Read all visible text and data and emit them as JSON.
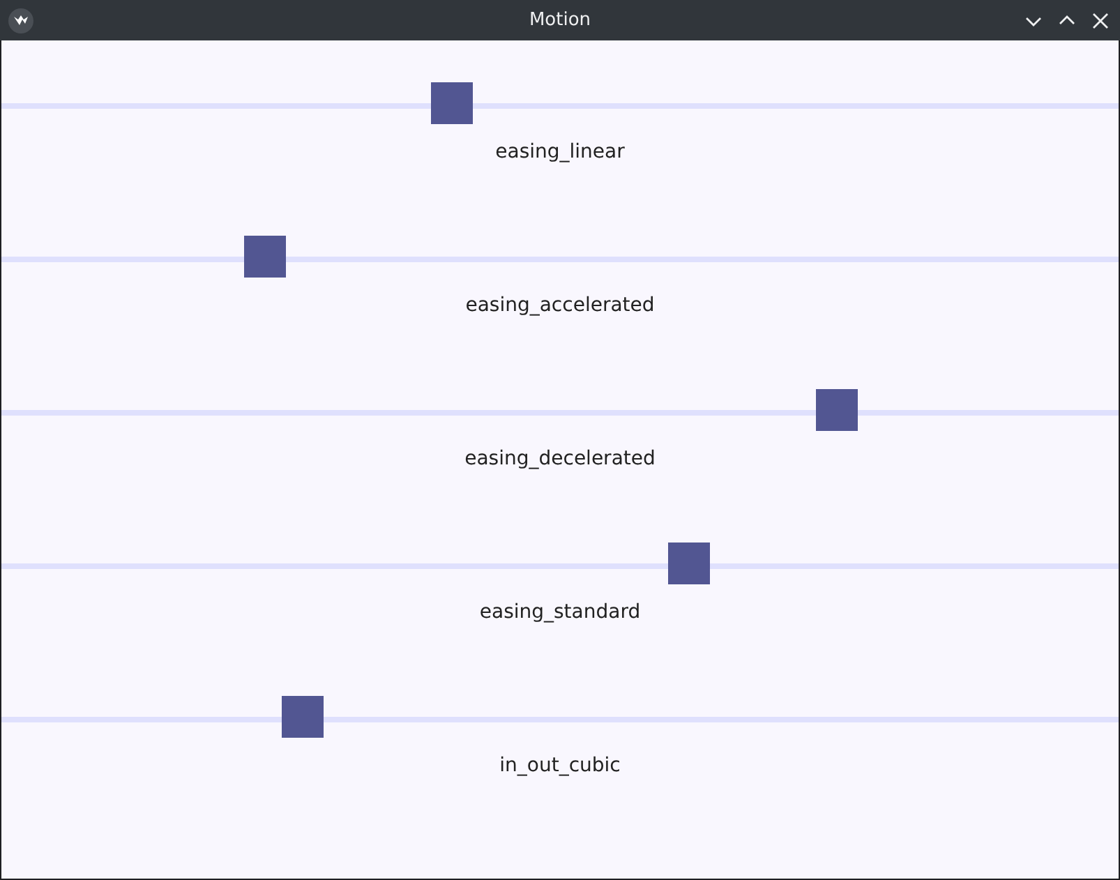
{
  "window": {
    "title": "Motion"
  },
  "rows": [
    {
      "label": "easing_linear",
      "level": 0.4
    },
    {
      "label": "easing_accelerated",
      "level": 0.226
    },
    {
      "label": "easing_decelerated",
      "level": 0.758
    },
    {
      "label": "easing_standard",
      "level": 0.62
    },
    {
      "label": "in_out_cubic",
      "level": 0.261
    }
  ]
}
